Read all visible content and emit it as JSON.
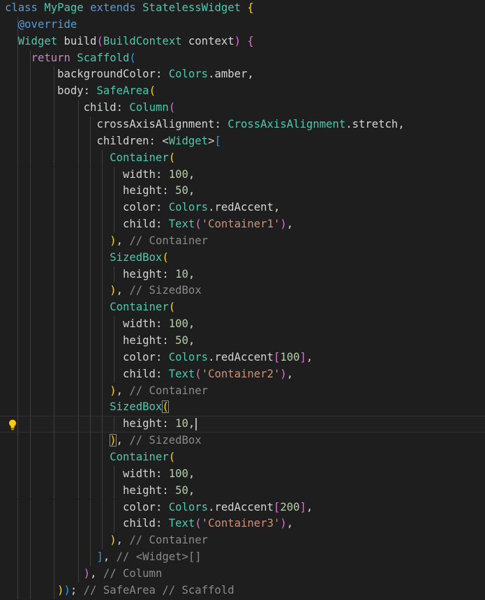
{
  "editor": {
    "language": "dart",
    "colors": {
      "background": "#1e1e1e",
      "keyword_blue": "#569cd6",
      "keyword_pink": "#c586c0",
      "class_teal": "#4ec9b0",
      "property_white": "#d4d4d4",
      "number_green": "#b5cea8",
      "string_orange": "#ce9178",
      "comment_gray": "#8a8a8a",
      "bracket_yellow": "#ffd700",
      "bracket_pink": "#da70d6",
      "bracket_blue": "#179fff"
    },
    "icons": {
      "lightbulb": "lightbulb-icon"
    },
    "lines": [
      [
        {
          "t": "class ",
          "c": "kw"
        },
        {
          "t": "MyPage ",
          "c": "cls"
        },
        {
          "t": "extends ",
          "c": "kw"
        },
        {
          "t": "StatelessWidget ",
          "c": "cls"
        },
        {
          "t": "{",
          "c": "b1"
        }
      ],
      [
        {
          "t": "  "
        },
        {
          "t": "@override",
          "c": "kw"
        }
      ],
      [
        {
          "t": "  "
        },
        {
          "t": "Widget ",
          "c": "cls"
        },
        {
          "t": "build",
          "c": "fn"
        },
        {
          "t": "(",
          "c": "b2"
        },
        {
          "t": "BuildContext ",
          "c": "cls"
        },
        {
          "t": "context",
          "c": "prop"
        },
        {
          "t": ")",
          "c": "b2"
        },
        {
          "t": " "
        },
        {
          "t": "{",
          "c": "b2"
        }
      ],
      [
        {
          "t": "    "
        },
        {
          "t": "return ",
          "c": "kw2"
        },
        {
          "t": "Scaffold",
          "c": "cls"
        },
        {
          "t": "(",
          "c": "b3"
        }
      ],
      [
        {
          "t": "        "
        },
        {
          "t": "backgroundColor",
          "c": "prop"
        },
        {
          "t": ": "
        },
        {
          "t": "Colors",
          "c": "cls"
        },
        {
          "t": ".amber,",
          "c": "prop"
        }
      ],
      [
        {
          "t": "        "
        },
        {
          "t": "body",
          "c": "prop"
        },
        {
          "t": ": "
        },
        {
          "t": "SafeArea",
          "c": "cls"
        },
        {
          "t": "(",
          "c": "b1"
        }
      ],
      [
        {
          "t": "            "
        },
        {
          "t": "child",
          "c": "prop"
        },
        {
          "t": ": "
        },
        {
          "t": "Column",
          "c": "cls"
        },
        {
          "t": "(",
          "c": "b2"
        }
      ],
      [
        {
          "t": "              "
        },
        {
          "t": "crossAxisAlignment",
          "c": "prop"
        },
        {
          "t": ": "
        },
        {
          "t": "CrossAxisAlignment",
          "c": "cls"
        },
        {
          "t": ".stretch,",
          "c": "prop"
        }
      ],
      [
        {
          "t": "              "
        },
        {
          "t": "children",
          "c": "prop"
        },
        {
          "t": ": <"
        },
        {
          "t": "Widget",
          "c": "cls"
        },
        {
          "t": ">"
        },
        {
          "t": "[",
          "c": "b3"
        }
      ],
      [
        {
          "t": "                "
        },
        {
          "t": "Container",
          "c": "cls"
        },
        {
          "t": "(",
          "c": "b1"
        }
      ],
      [
        {
          "t": "                  "
        },
        {
          "t": "width",
          "c": "prop"
        },
        {
          "t": ": "
        },
        {
          "t": "100",
          "c": "num"
        },
        {
          "t": ","
        }
      ],
      [
        {
          "t": "                  "
        },
        {
          "t": "height",
          "c": "prop"
        },
        {
          "t": ": "
        },
        {
          "t": "50",
          "c": "num"
        },
        {
          "t": ","
        }
      ],
      [
        {
          "t": "                  "
        },
        {
          "t": "color",
          "c": "prop"
        },
        {
          "t": ": "
        },
        {
          "t": "Colors",
          "c": "cls"
        },
        {
          "t": ".redAccent,",
          "c": "prop"
        }
      ],
      [
        {
          "t": "                  "
        },
        {
          "t": "child",
          "c": "prop"
        },
        {
          "t": ": "
        },
        {
          "t": "Text",
          "c": "cls"
        },
        {
          "t": "(",
          "c": "b2"
        },
        {
          "t": "'Container1'",
          "c": "str"
        },
        {
          "t": ")",
          "c": "b2"
        },
        {
          "t": ","
        }
      ],
      [
        {
          "t": "                "
        },
        {
          "t": ")",
          "c": "b1"
        },
        {
          "t": ", "
        },
        {
          "t": "// Container",
          "c": "cmt"
        }
      ],
      [
        {
          "t": "                "
        },
        {
          "t": "SizedBox",
          "c": "cls"
        },
        {
          "t": "(",
          "c": "b1"
        }
      ],
      [
        {
          "t": "                  "
        },
        {
          "t": "height",
          "c": "prop"
        },
        {
          "t": ": "
        },
        {
          "t": "10",
          "c": "num"
        },
        {
          "t": ","
        }
      ],
      [
        {
          "t": "                "
        },
        {
          "t": ")",
          "c": "b1"
        },
        {
          "t": ", "
        },
        {
          "t": "// SizedBox",
          "c": "cmt"
        }
      ],
      [
        {
          "t": "                "
        },
        {
          "t": "Container",
          "c": "cls"
        },
        {
          "t": "(",
          "c": "b1"
        }
      ],
      [
        {
          "t": "                  "
        },
        {
          "t": "width",
          "c": "prop"
        },
        {
          "t": ": "
        },
        {
          "t": "100",
          "c": "num"
        },
        {
          "t": ","
        }
      ],
      [
        {
          "t": "                  "
        },
        {
          "t": "height",
          "c": "prop"
        },
        {
          "t": ": "
        },
        {
          "t": "50",
          "c": "num"
        },
        {
          "t": ","
        }
      ],
      [
        {
          "t": "                  "
        },
        {
          "t": "color",
          "c": "prop"
        },
        {
          "t": ": "
        },
        {
          "t": "Colors",
          "c": "cls"
        },
        {
          "t": ".redAccent",
          "c": "prop"
        },
        {
          "t": "[",
          "c": "b2"
        },
        {
          "t": "100",
          "c": "num"
        },
        {
          "t": "]",
          "c": "b2"
        },
        {
          "t": ","
        }
      ],
      [
        {
          "t": "                  "
        },
        {
          "t": "child",
          "c": "prop"
        },
        {
          "t": ": "
        },
        {
          "t": "Text",
          "c": "cls"
        },
        {
          "t": "(",
          "c": "b2"
        },
        {
          "t": "'Container2'",
          "c": "str"
        },
        {
          "t": ")",
          "c": "b2"
        },
        {
          "t": ","
        }
      ],
      [
        {
          "t": "                "
        },
        {
          "t": ")",
          "c": "b1"
        },
        {
          "t": ", "
        },
        {
          "t": "// Container",
          "c": "cmt"
        }
      ],
      [
        {
          "t": "                "
        },
        {
          "t": "SizedBox",
          "c": "cls"
        },
        {
          "t": "(",
          "c": "b1",
          "hl": true
        }
      ],
      [
        {
          "t": "                  "
        },
        {
          "t": "height",
          "c": "prop"
        },
        {
          "t": ": "
        },
        {
          "t": "10",
          "c": "num"
        },
        {
          "t": ","
        }
      ],
      [
        {
          "t": "                "
        },
        {
          "t": ")",
          "c": "b1",
          "hl": true
        },
        {
          "t": ", "
        },
        {
          "t": "// SizedBox",
          "c": "cmt"
        }
      ],
      [
        {
          "t": "                "
        },
        {
          "t": "Container",
          "c": "cls"
        },
        {
          "t": "(",
          "c": "b1"
        }
      ],
      [
        {
          "t": "                  "
        },
        {
          "t": "width",
          "c": "prop"
        },
        {
          "t": ": "
        },
        {
          "t": "100",
          "c": "num"
        },
        {
          "t": ","
        }
      ],
      [
        {
          "t": "                  "
        },
        {
          "t": "height",
          "c": "prop"
        },
        {
          "t": ": "
        },
        {
          "t": "50",
          "c": "num"
        },
        {
          "t": ","
        }
      ],
      [
        {
          "t": "                  "
        },
        {
          "t": "color",
          "c": "prop"
        },
        {
          "t": ": "
        },
        {
          "t": "Colors",
          "c": "cls"
        },
        {
          "t": ".redAccent",
          "c": "prop"
        },
        {
          "t": "[",
          "c": "b2"
        },
        {
          "t": "200",
          "c": "num"
        },
        {
          "t": "]",
          "c": "b2"
        },
        {
          "t": ","
        }
      ],
      [
        {
          "t": "                  "
        },
        {
          "t": "child",
          "c": "prop"
        },
        {
          "t": ": "
        },
        {
          "t": "Text",
          "c": "cls"
        },
        {
          "t": "(",
          "c": "b2"
        },
        {
          "t": "'Container3'",
          "c": "str"
        },
        {
          "t": ")",
          "c": "b2"
        },
        {
          "t": ","
        }
      ],
      [
        {
          "t": "                "
        },
        {
          "t": ")",
          "c": "b1"
        },
        {
          "t": ", "
        },
        {
          "t": "// Container",
          "c": "cmt"
        }
      ],
      [
        {
          "t": "              "
        },
        {
          "t": "]",
          "c": "b3"
        },
        {
          "t": ", "
        },
        {
          "t": "// <Widget>[]",
          "c": "cmt"
        }
      ],
      [
        {
          "t": "            "
        },
        {
          "t": ")",
          "c": "b2"
        },
        {
          "t": ", "
        },
        {
          "t": "// Column",
          "c": "cmt"
        }
      ],
      [
        {
          "t": "        "
        },
        {
          "t": ")",
          "c": "b1"
        },
        {
          "t": ")",
          "c": "b3"
        },
        {
          "t": "; "
        },
        {
          "t": "// SafeArea // Scaffold",
          "c": "cmt"
        }
      ],
      [
        {
          "t": "  "
        },
        {
          "t": "}",
          "c": "b2"
        }
      ]
    ],
    "current_line_index": 25,
    "lightbulb_line_index": 25,
    "guides": [
      [],
      [
        1
      ],
      [
        1
      ],
      [
        1,
        2
      ],
      [
        1,
        2,
        4
      ],
      [
        1,
        2,
        4
      ],
      [
        1,
        2,
        4,
        6
      ],
      [
        1,
        2,
        4,
        6,
        7
      ],
      [
        1,
        2,
        4,
        6,
        7
      ],
      [
        1,
        2,
        4,
        6,
        7,
        8
      ],
      [
        1,
        2,
        4,
        6,
        7,
        8,
        9
      ],
      [
        1,
        2,
        4,
        6,
        7,
        8,
        9
      ],
      [
        1,
        2,
        4,
        6,
        7,
        8,
        9
      ],
      [
        1,
        2,
        4,
        6,
        7,
        8,
        9
      ],
      [
        1,
        2,
        4,
        6,
        7,
        8
      ],
      [
        1,
        2,
        4,
        6,
        7,
        8
      ],
      [
        1,
        2,
        4,
        6,
        7,
        8,
        9
      ],
      [
        1,
        2,
        4,
        6,
        7,
        8
      ],
      [
        1,
        2,
        4,
        6,
        7,
        8
      ],
      [
        1,
        2,
        4,
        6,
        7,
        8,
        9
      ],
      [
        1,
        2,
        4,
        6,
        7,
        8,
        9
      ],
      [
        1,
        2,
        4,
        6,
        7,
        8,
        9
      ],
      [
        1,
        2,
        4,
        6,
        7,
        8,
        9
      ],
      [
        1,
        2,
        4,
        6,
        7,
        8
      ],
      [
        1,
        2,
        4,
        6,
        7,
        8
      ],
      [
        1,
        2,
        4,
        6,
        7,
        8,
        9
      ],
      [
        1,
        2,
        4,
        6,
        7,
        8
      ],
      [
        1,
        2,
        4,
        6,
        7,
        8
      ],
      [
        1,
        2,
        4,
        6,
        7,
        8,
        9
      ],
      [
        1,
        2,
        4,
        6,
        7,
        8,
        9
      ],
      [
        1,
        2,
        4,
        6,
        7,
        8,
        9
      ],
      [
        1,
        2,
        4,
        6,
        7,
        8,
        9
      ],
      [
        1,
        2,
        4,
        6,
        7,
        8
      ],
      [
        1,
        2,
        4,
        6,
        7
      ],
      [
        1,
        2,
        4,
        6
      ],
      [
        1,
        2,
        4
      ],
      []
    ]
  }
}
